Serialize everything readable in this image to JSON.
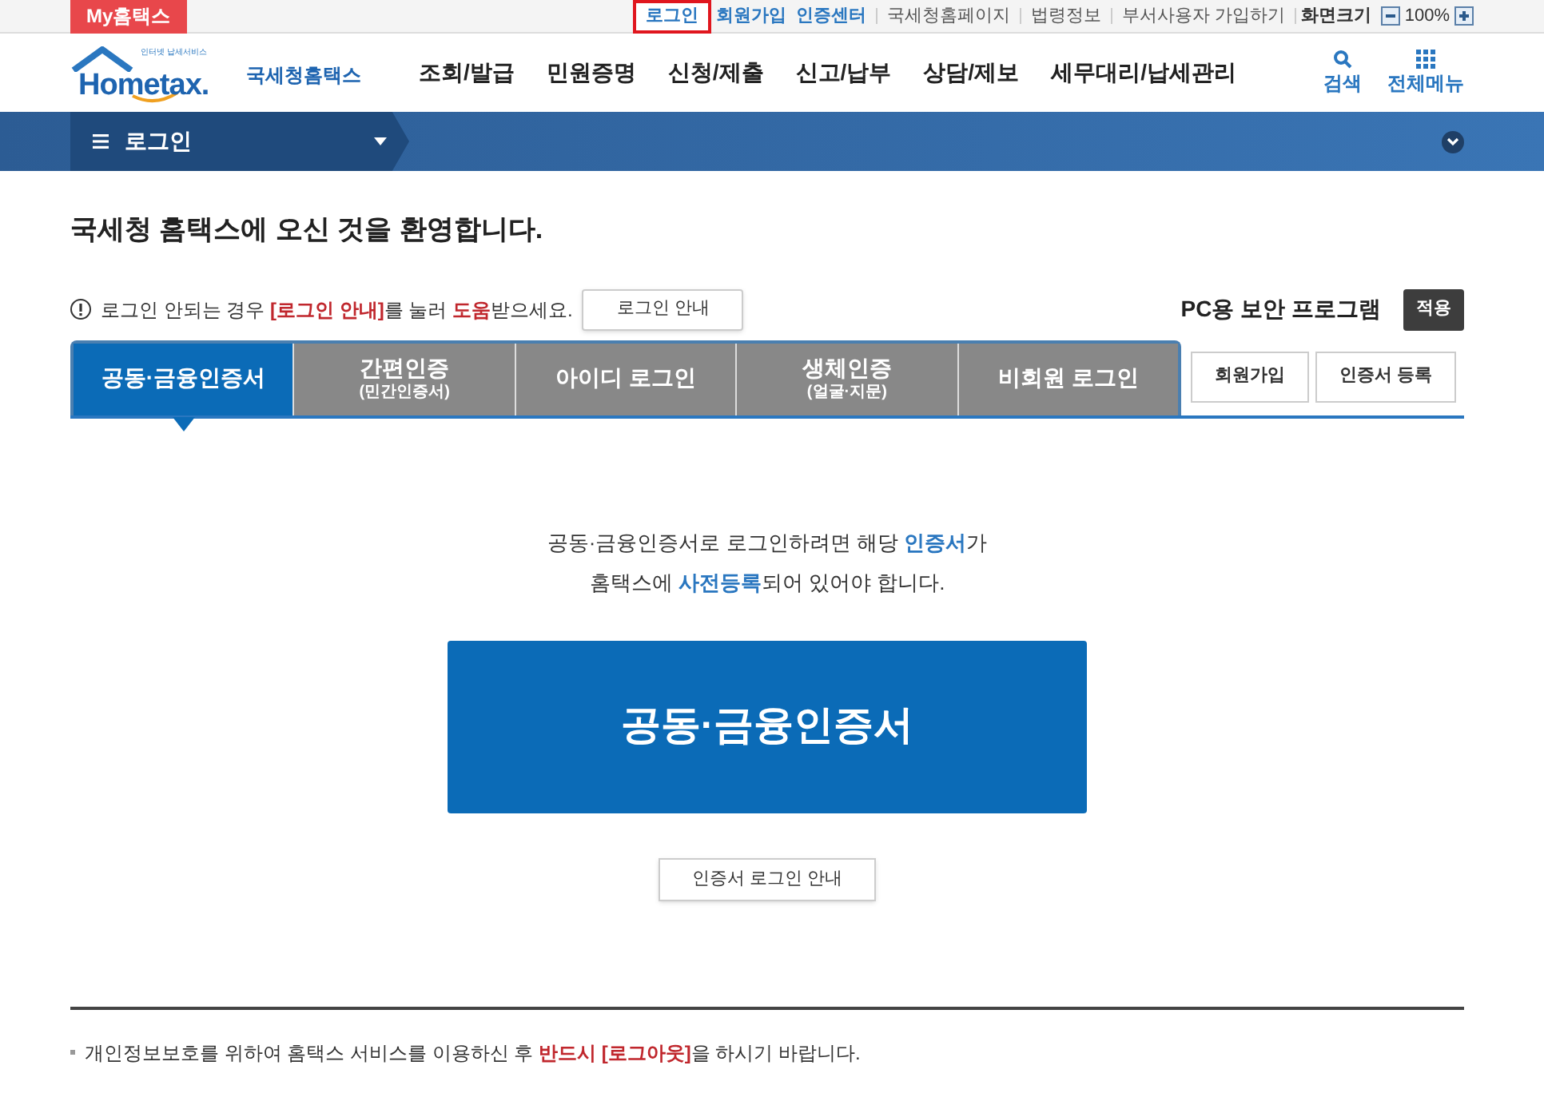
{
  "top_bar": {
    "badge": "My홈택스",
    "links": [
      {
        "label": "로그인",
        "kind": "accent",
        "selected": true
      },
      {
        "label": "회원가입",
        "kind": "accent",
        "selected": false
      },
      {
        "label": "인증센터",
        "kind": "accent",
        "selected": false
      },
      {
        "label": "국세청홈페이지",
        "kind": "plain",
        "selected": false
      },
      {
        "label": "법령정보",
        "kind": "plain",
        "selected": false
      },
      {
        "label": "부서사용자 가입하기",
        "kind": "plain",
        "selected": false
      }
    ],
    "zoom_label": "화면크기",
    "zoom_value": "100%"
  },
  "header": {
    "logo_small": "인터넷 납세서비스",
    "logo_wordmark": "Hometax.",
    "logo_name": "국세청홈택스",
    "menu": [
      "조회/발급",
      "민원증명",
      "신청/제출",
      "신고/납부",
      "상담/제보",
      "세무대리/납세관리"
    ],
    "search_label": "검색",
    "all_menu_label": "전체메뉴"
  },
  "breadcrumb": {
    "label": "로그인"
  },
  "welcome": "국세청 홈택스에 오신 것을 환영합니다.",
  "notice": {
    "text": "로그인 안되는 경우 **[로그인 안내]**를 눌러 **도움**받으세요.",
    "button": "로그인 안내"
  },
  "security": {
    "label": "PC용 보안 프로그램",
    "button": "적용"
  },
  "tabs": [
    {
      "label": "공동·금융인증서",
      "selected": true
    },
    {
      "label": "간편인증",
      "sublabel": "(민간인증서)",
      "selected": false
    },
    {
      "label": "아이디 로그인",
      "selected": false
    },
    {
      "label": "생체인증",
      "sublabel": "(얼굴·지문)",
      "selected": false
    },
    {
      "label": "비회원 로그인",
      "selected": false
    }
  ],
  "side_buttons": [
    "회원가입",
    "인증서 등록"
  ],
  "cert_info": [
    "공동·금융인증서로 로그인하려면 해당 **인증서**가",
    "홈택스에 **사전등록**되어 있어야 합니다."
  ],
  "cert_button": "공동·금융인증서",
  "cert_guide_button": "인증서 로그인 안내",
  "footer_note": "개인정보보호를 위하여 홈택스 서비스를 이용하신 후 **반드시 [로그아웃]**을 하시기 바랍니다."
}
